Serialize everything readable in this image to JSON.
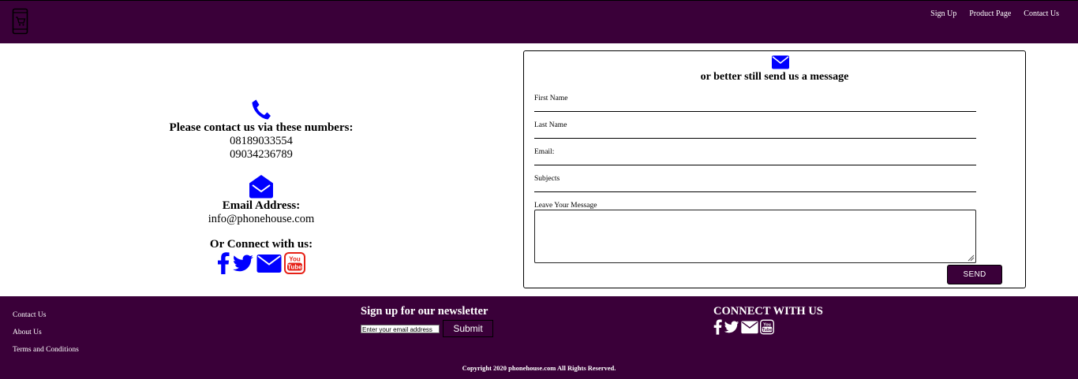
{
  "header": {
    "nav": [
      "Sign Up",
      "Product Page",
      "Contact Us"
    ],
    "logo_icon": "phone-cart-icon"
  },
  "contact": {
    "phone_icon": "phone-icon",
    "phone_heading": "Please contact us via these numbers:",
    "phones": [
      "08189033554",
      "09034236789"
    ],
    "email_icon": "envelope-open-icon",
    "email_heading": "Email Address:",
    "email": "info@phonehouse.com",
    "social_heading": "Or Connect with us:",
    "social_icons": [
      "facebook-icon",
      "twitter-icon",
      "envelope-icon",
      "youtube-icon"
    ],
    "icon_color": "#0000ff",
    "youtube_color": "#e62117"
  },
  "form": {
    "title": "or better still send us a message",
    "fields": [
      "First Name",
      "Last Name",
      "Email:",
      "Subjects"
    ],
    "message_label": "Leave Your Message",
    "send_label": "SEND"
  },
  "footer": {
    "links": [
      "Contact Us",
      "About Us",
      "Terms and Conditions"
    ],
    "newsletter_title": "Sign up for our newsletter",
    "newsletter_placeholder": "Enter your email address",
    "submit_label": "Submit",
    "connect_title": "CONNECT WITH US",
    "copyright": "Copyright 2020 phonehouse.com All Rights Reserved."
  },
  "colors": {
    "brand": "#3a0039",
    "accent_blue": "#0000ff"
  }
}
